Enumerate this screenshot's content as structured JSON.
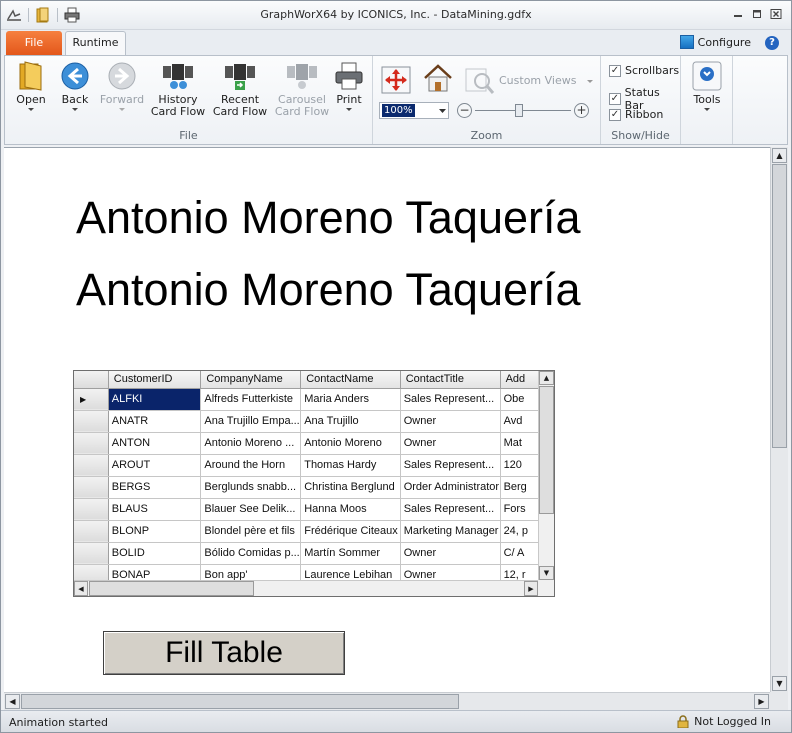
{
  "window": {
    "title": "GraphWorX64 by ICONICS, Inc. - DataMining.gdfx"
  },
  "tabs": {
    "file": "File",
    "runtime": "Runtime",
    "configure": "Configure",
    "help": "?"
  },
  "ribbon": {
    "file_group": {
      "label": "File",
      "open": "Open",
      "back": "Back",
      "forward": "Forward",
      "history_line1": "History",
      "history_line2": "Card Flow",
      "recent_line1": "Recent",
      "recent_line2": "Card Flow",
      "carousel_line1": "Carousel",
      "carousel_line2": "Card Flow",
      "print": "Print"
    },
    "zoom_group": {
      "label": "Zoom",
      "zoom_value": "100%",
      "custom_views": "Custom Views"
    },
    "showhide_group": {
      "label": "Show/Hide",
      "scrollbars": "Scrollbars",
      "status_bar": "Status Bar",
      "ribbon": "Ribbon",
      "check": "✓"
    },
    "tools": {
      "label": "Tools"
    }
  },
  "display": {
    "heading1": "Antonio Moreno Taquería",
    "heading2": "Antonio Moreno Taquería",
    "fill_button": "Fill Table",
    "grid": {
      "columns": [
        "CustomerID",
        "CompanyName",
        "ContactName",
        "ContactTitle",
        "Add"
      ],
      "current_row_marker": "▶",
      "rows": [
        [
          "ALFKI",
          "Alfreds Futterkiste",
          "Maria Anders",
          "Sales Represent...",
          "Obe"
        ],
        [
          "ANATR",
          "Ana Trujillo Empa...",
          "Ana Trujillo",
          "Owner",
          "Avd"
        ],
        [
          "ANTON",
          "Antonio Moreno ...",
          "Antonio Moreno",
          "Owner",
          "Mat"
        ],
        [
          "AROUT",
          "Around the Horn",
          "Thomas Hardy",
          "Sales Represent...",
          "120"
        ],
        [
          "BERGS",
          "Berglunds snabb...",
          "Christina Berglund",
          "Order Administrator",
          "Berg"
        ],
        [
          "BLAUS",
          "Blauer See Delik...",
          "Hanna Moos",
          "Sales Represent...",
          "Fors"
        ],
        [
          "BLONP",
          "Blondel père et fils",
          "Frédérique Citeaux",
          "Marketing Manager",
          "24, p"
        ],
        [
          "BOLID",
          "Bólido Comidas p...",
          "Martín Sommer",
          "Owner",
          "C/ A"
        ],
        [
          "BONAP",
          "Bon app'",
          "Laurence Lebihan",
          "Owner",
          "12, r"
        ]
      ]
    }
  },
  "statusbar": {
    "left": "Animation started",
    "right": "Not Logged In"
  }
}
